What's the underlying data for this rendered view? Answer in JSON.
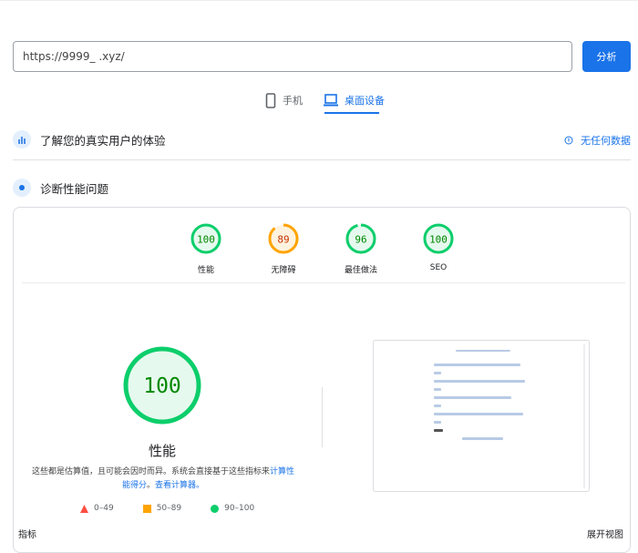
{
  "search": {
    "url": "https://9999_ .xyz/",
    "button": "分析"
  },
  "tabs": [
    {
      "label": "手机",
      "icon": "phone-icon",
      "active": false
    },
    {
      "label": "桌面设备",
      "icon": "laptop-icon",
      "active": true
    }
  ],
  "field_data": {
    "title": "了解您的真实用户的体验",
    "status": "无任何数据"
  },
  "diagnose": {
    "title": "诊断性能问题"
  },
  "scores": [
    {
      "label": "性能",
      "value": 100,
      "color": "#0cce6b"
    },
    {
      "label": "无障碍",
      "value": 89,
      "color": "#ffa400"
    },
    {
      "label": "最佳做法",
      "value": 96,
      "color": "#0cce6b"
    },
    {
      "label": "SEO",
      "value": 100,
      "color": "#0cce6b"
    }
  ],
  "main_score": {
    "value": 100,
    "label": "性能",
    "desc": "这些都是估算值，且可能会因时而异。系统会直接基于这些指标来",
    "link1": "计算性能得分",
    "sep": "。",
    "link2": "查看计算器。"
  },
  "legend": [
    {
      "range": "0–49",
      "color": "#ff4e42",
      "shape": "triangle"
    },
    {
      "range": "50–89",
      "color": "#ffa400",
      "shape": "square"
    },
    {
      "range": "90–100",
      "color": "#0cce6b",
      "shape": "circle"
    }
  ],
  "bottom": {
    "metrics": "指标",
    "expand": "展开视图"
  }
}
